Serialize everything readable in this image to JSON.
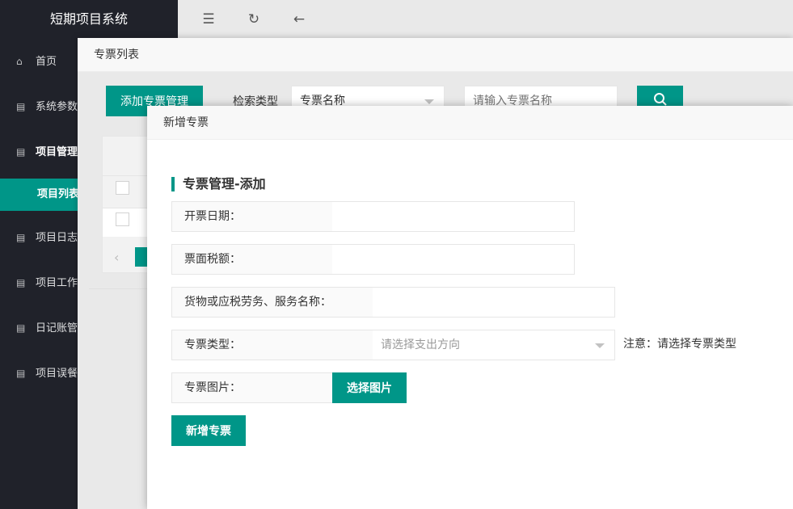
{
  "app": {
    "title": "短期项目系统"
  },
  "sidebar": {
    "items": [
      {
        "icon": "⌂",
        "label": "首页"
      },
      {
        "icon": "▤",
        "label": "系统参数"
      },
      {
        "icon": "▤",
        "label": "项目管理"
      },
      {
        "icon": "",
        "label": "项目列表"
      },
      {
        "icon": "▤",
        "label": "项目日志"
      },
      {
        "icon": "▤",
        "label": "项目工作"
      },
      {
        "icon": "▤",
        "label": "日记账管"
      },
      {
        "icon": "▤",
        "label": "项目误餐"
      }
    ]
  },
  "topbar": {
    "menu_icon": "☰",
    "refresh_icon": "↻",
    "back_icon": "←"
  },
  "list_layer": {
    "title": "专票列表",
    "add_button": "添加专票管理",
    "search_type_label": "检索类型",
    "search_type_value": "专票名称",
    "search_placeholder": "请输入专票名称",
    "prev_icon": "‹"
  },
  "add_layer": {
    "title": "新增专票",
    "heading": "专票管理-添加",
    "fields": {
      "date_label": "开票日期：",
      "tax_label": "票面税额：",
      "goods_label": "货物或应税劳务、服务名称：",
      "type_label": "专票类型：",
      "type_placeholder": "请选择支出方向",
      "type_note": "注意：请选择专票类型",
      "image_label": "专票图片：",
      "image_button": "选择图片"
    },
    "submit_button": "新增专票"
  },
  "colors": {
    "accent": "#009688",
    "sidebar_bg": "#20222a"
  }
}
